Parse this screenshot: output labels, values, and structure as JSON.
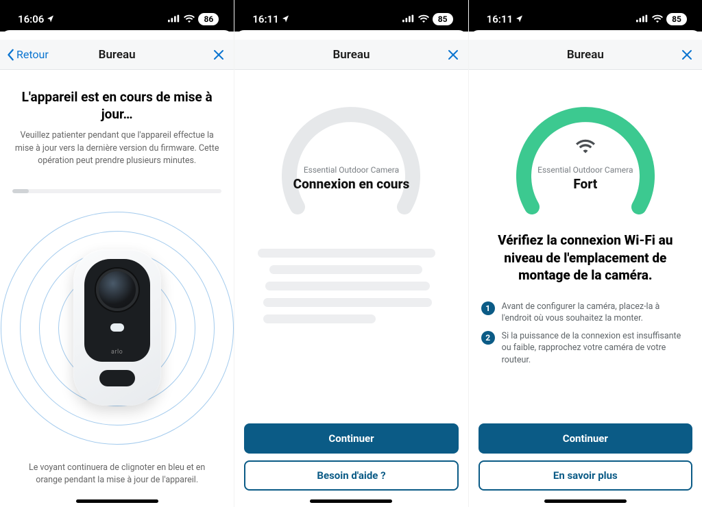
{
  "screens": [
    {
      "status": {
        "time": "16:06",
        "battery": "86"
      },
      "nav": {
        "back": "Retour",
        "title": "Bureau"
      },
      "title": "L'appareil est en cours de mise à jour…",
      "subtitle": "Veuillez patienter pendant que l'appareil effectue la mise à jour vers la dernière version du firmware. Cette opération peut prendre plusieurs minutes.",
      "footer": "Le voyant continuera de clignoter en bleu et en orange pendant la mise à jour de l'appareil.",
      "camera_brand": "arlo"
    },
    {
      "status": {
        "time": "16:11",
        "battery": "85"
      },
      "nav": {
        "title": "Bureau"
      },
      "gauge": {
        "device": "Essential Outdoor Camera",
        "status": "Connexion en cours"
      },
      "buttons": {
        "primary": "Continuer",
        "secondary": "Besoin d'aide ?"
      }
    },
    {
      "status": {
        "time": "16:11",
        "battery": "85"
      },
      "nav": {
        "title": "Bureau"
      },
      "gauge": {
        "device": "Essential Outdoor Camera",
        "status": "Fort"
      },
      "title": "Vérifiez la connexion Wi-Fi au niveau de l'emplacement de montage de la caméra.",
      "steps": [
        "Avant de configurer la caméra, placez-la à l'endroit où vous souhaitez la monter.",
        "Si la puissance de la connexion est insuffisante ou faible, rapprochez votre caméra de votre routeur."
      ],
      "buttons": {
        "primary": "Continuer",
        "secondary": "En savoir plus"
      }
    }
  ]
}
